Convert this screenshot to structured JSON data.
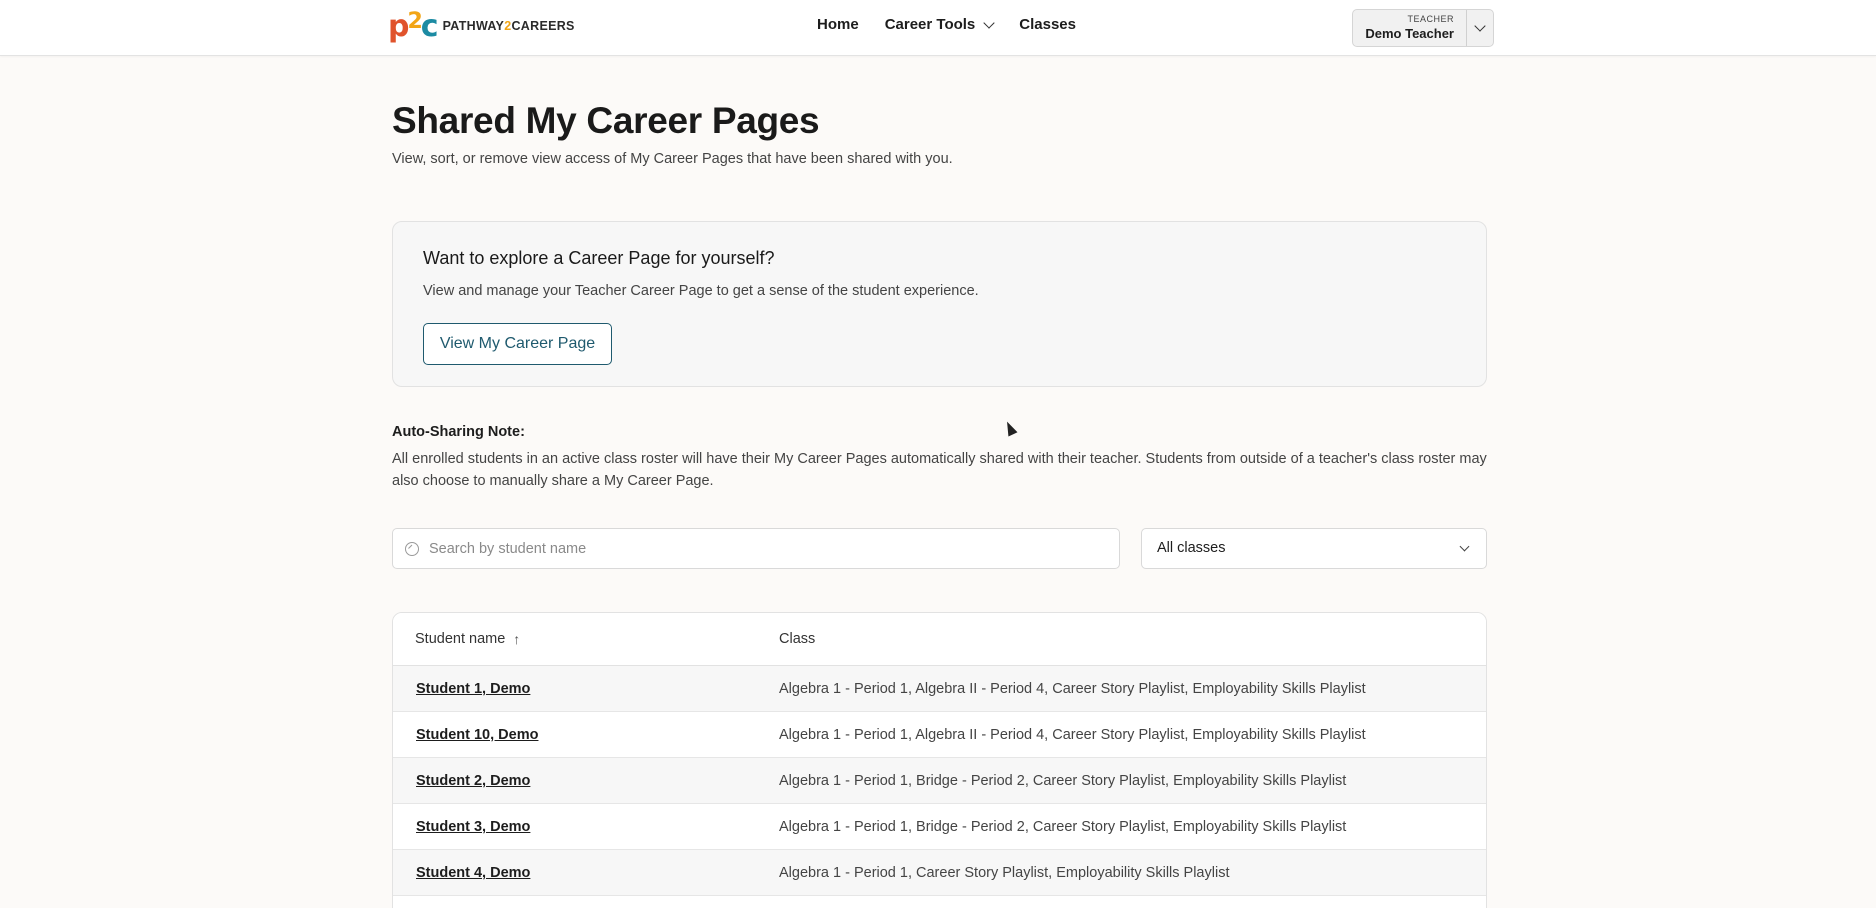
{
  "header": {
    "logo_mark_p": "p",
    "logo_mark_two": "2",
    "logo_mark_c": "c",
    "logo_text_a": "PATHWAY",
    "logo_text_num": "2",
    "logo_text_b": "CAREERS",
    "nav": [
      {
        "label": "Home"
      },
      {
        "label": "Career Tools"
      },
      {
        "label": "Classes"
      }
    ],
    "user": {
      "role": "TEACHER",
      "name": "Demo Teacher"
    }
  },
  "page": {
    "title": "Shared My Career Pages",
    "subtitle": "View, sort, or remove view access of My Career Pages that have been shared with you."
  },
  "card": {
    "title": "Want to explore a Career Page for yourself?",
    "description": "View and manage your Teacher Career Page to get a sense of the student experience.",
    "button_label": "View My Career Page"
  },
  "note": {
    "title": "Auto-Sharing Note:",
    "text": "All enrolled students in an active class roster will have their My Career Pages automatically shared with their teacher. Students from outside of a teacher's class roster may also choose to manually share a My Career Page."
  },
  "filters": {
    "search_placeholder": "Search by student name",
    "search_value": "",
    "class_selected": "All classes"
  },
  "table": {
    "headers": {
      "name": "Student name",
      "sort_indicator": "↑",
      "class": "Class"
    },
    "rows": [
      {
        "name": "Student 1, Demo",
        "class": "Algebra 1 - Period 1, Algebra II - Period 4, Career Story Playlist, Employability Skills Playlist"
      },
      {
        "name": "Student 10, Demo",
        "class": "Algebra 1 - Period 1, Algebra II - Period 4, Career Story Playlist, Employability Skills Playlist"
      },
      {
        "name": "Student 2, Demo",
        "class": "Algebra 1 - Period 1, Bridge - Period 2, Career Story Playlist, Employability Skills Playlist"
      },
      {
        "name": "Student 3, Demo",
        "class": "Algebra 1 - Period 1, Bridge - Period 2, Career Story Playlist, Employability Skills Playlist"
      },
      {
        "name": "Student 4, Demo",
        "class": "Algebra 1 - Period 1, Career Story Playlist, Employability Skills Playlist"
      }
    ]
  },
  "colors": {
    "background": "#fcfaf8",
    "accent": "#1f5a6e",
    "logo_orange": "#e0532c",
    "logo_yellow": "#f2a516",
    "logo_teal": "#1c8ba3"
  }
}
